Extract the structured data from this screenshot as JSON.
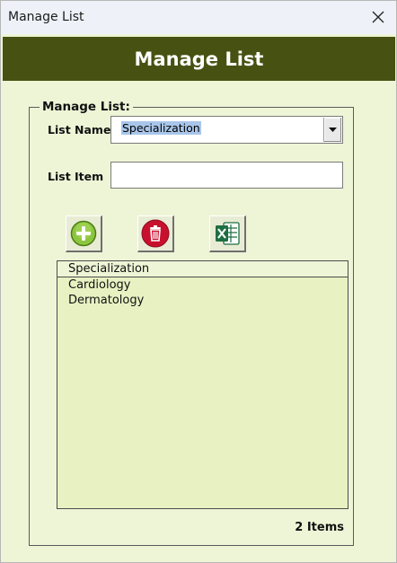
{
  "window": {
    "title": "Manage List"
  },
  "header": {
    "title": "Manage List"
  },
  "group": {
    "title": "Manage List:"
  },
  "form": {
    "list_name_label": "List Name",
    "list_name_value": "Specialization",
    "list_item_label": "List Item",
    "list_item_value": ""
  },
  "toolbar": {
    "add_icon": "plus-circle-icon",
    "delete_icon": "trash-icon",
    "export_icon": "excel-icon"
  },
  "list": {
    "header": "Specialization",
    "items": [
      "Cardiology",
      "Dermatology"
    ]
  },
  "footer": {
    "count": "2 Items"
  },
  "colors": {
    "header_bg": "#475212",
    "panel_bg": "#eef5d6",
    "list_bg": "#e8f1c2",
    "add_green": "#8cc63f",
    "delete_red": "#c8102e",
    "excel_green": "#1d6f42"
  }
}
